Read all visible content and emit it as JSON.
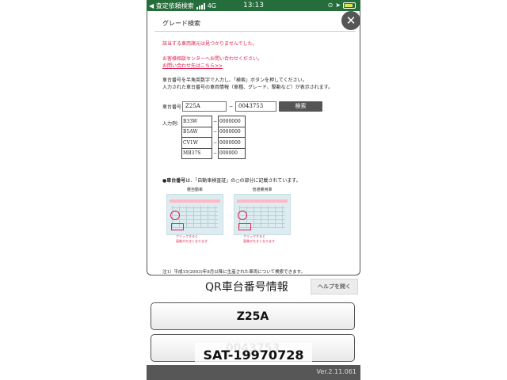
{
  "status_bar": {
    "carrier_back": "◀ 査定依頼検索",
    "network": "4G",
    "time": "13:13",
    "color": "#256d3a"
  },
  "dialog": {
    "title": "グレード検索",
    "close_icon": "close-icon",
    "error_lines": [
      "該当する車両諸元は見つかりませんでした。",
      "お客様相談センターへお問い合わせください。",
      "お問い合わせ先はこちら>>"
    ],
    "guide_lines": [
      "車台番号を半角英数字で入力し、「検索」ボタンを押してください。",
      "入力された車台番号の車両情報（車種、グレード、駆動など）が表示されます。"
    ],
    "vin_label": "車台番号",
    "model_value": "Z25A",
    "dash": "−",
    "serial_value": "0043753",
    "search_button": "検索",
    "examples_label": "入力例：",
    "examples": [
      {
        "model": "B33W",
        "serial": "0000000"
      },
      {
        "model": "B5AW",
        "serial": "0000000"
      },
      {
        "model": "CV1W",
        "serial": "0000000"
      },
      {
        "model": "MB37S",
        "serial": "000000"
      }
    ],
    "note_bold": "●車台番号",
    "note_rest": "は、「自動車検査証」の○の部分に記載されています。",
    "doc_left_caption": "軽自動車",
    "doc_right_caption": "普通乗用車",
    "doc_hint_1": "クリックすると",
    "doc_hint_2": "画像が大きくなります",
    "footnote": "注1）平成15(2003)年8月以降に生産された車両について検索できます。"
  },
  "native": {
    "title": "QR車台番号情報",
    "help_button": "ヘルプを開く",
    "model_button": "Z25A",
    "serial_button": "0043753",
    "overlay": "SAT-19970728",
    "version": "Ver.2.11.061"
  }
}
